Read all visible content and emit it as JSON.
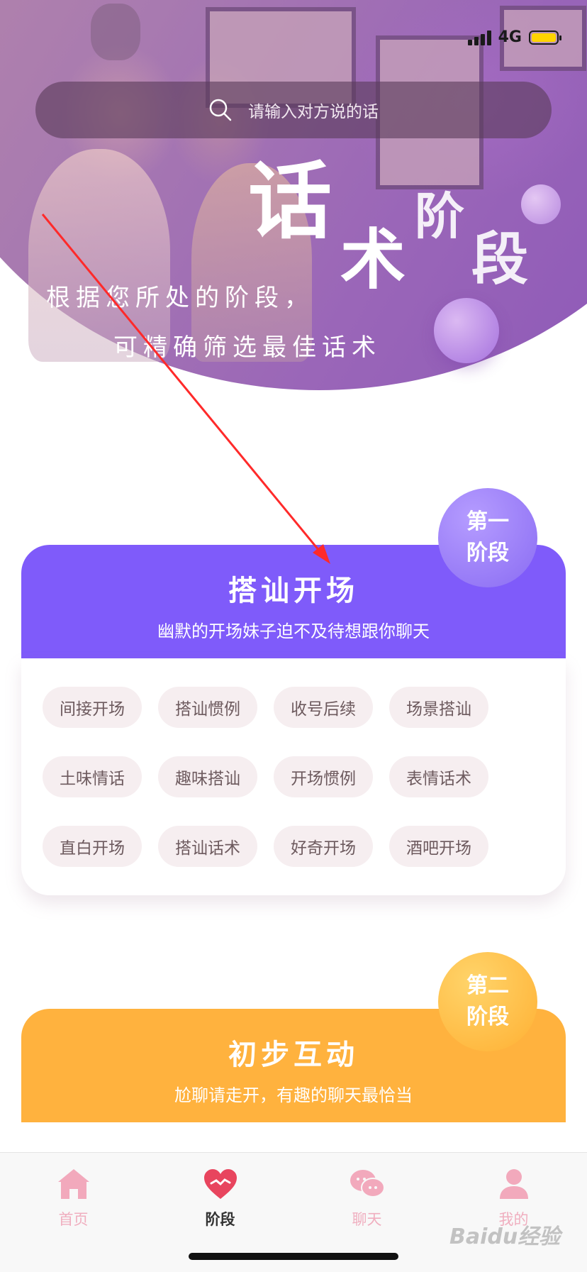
{
  "status_bar": {
    "network": "4G"
  },
  "search": {
    "placeholder": "请输入对方说的话"
  },
  "hero": {
    "title_chars": [
      "话",
      "术",
      "阶",
      "段"
    ],
    "desc_line1": "根据您所处的阶段，",
    "desc_line2": "可精确筛选最佳话术"
  },
  "stages": [
    {
      "badge_line1": "第一",
      "badge_line2": "阶段",
      "title": "搭讪开场",
      "subtitle": "幽默的开场妹子迫不及待想跟你聊天",
      "color": "#7f5bfa",
      "tags": [
        "间接开场",
        "搭讪惯例",
        "收号后续",
        "场景搭讪",
        "土味情话",
        "趣味搭讪",
        "开场惯例",
        "表情话术",
        "直白开场",
        "搭讪话术",
        "好奇开场",
        "酒吧开场"
      ]
    },
    {
      "badge_line1": "第二",
      "badge_line2": "阶段",
      "title": "初步互动",
      "subtitle": "尬聊请走开，有趣的聊天最恰当",
      "color": "#ffb23e"
    }
  ],
  "tabbar": {
    "items": [
      {
        "label": "首页",
        "icon": "home-icon"
      },
      {
        "label": "阶段",
        "icon": "heart-icon",
        "active": true
      },
      {
        "label": "聊天",
        "icon": "chat-bubbles-icon"
      },
      {
        "label": "我的",
        "icon": "user-icon"
      }
    ]
  },
  "colors": {
    "accent_pink": "#f0aebf",
    "stage1": "#7f5bfa",
    "stage2": "#ffb23e"
  },
  "watermark": "Baidu经验"
}
